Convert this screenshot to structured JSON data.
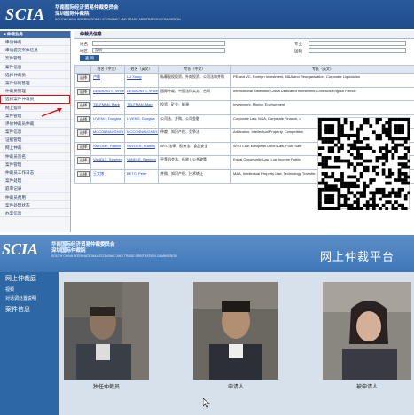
{
  "top": {
    "logo": "SCIA",
    "org_cn": "华南国际经济贸易仲裁委员会",
    "org_cn2": "深圳国际仲裁院",
    "org_en": "SOUTH CHINA INTERNATIONAL ECONOMIC AND TRADE ARBITRATION COMMISSION",
    "sidebar_head": "■ 仲裁业务",
    "sidebar_items": [
      "申请仲裁",
      "申请提交案件信息",
      "案件管理",
      "案件信息",
      "选择仲裁员",
      "案件标的管理",
      "仲裁员管理",
      "选择案件仲裁员",
      "网上提审",
      "案件管理",
      "评价仲裁员仲裁",
      "案件信息",
      "证据管理",
      "网上仲裁",
      "仲裁员签名",
      "案件管理",
      "仲裁员工作日志",
      "案件处理",
      "庭审记录",
      "仲裁员费用",
      "案件处理状态",
      "办案信息"
    ],
    "main_title": "仲裁员信息",
    "filter": {
      "name_label": "姓名",
      "region_label": "地区",
      "region_value": "深圳",
      "specialty_label": "专业",
      "nationality_label": "国籍",
      "search_button": "查 询"
    },
    "table_headers": [
      "",
      "姓名（中文）",
      "姓名（英文）",
      "专长（中文）",
      "专长（英文）"
    ],
    "rows": [
      {
        "sel": "选择",
        "cn": "卢雄",
        "en": "LU Xiong",
        "spec_cn": "私募股权投资、外商投资、公司法和并购",
        "spec_en": "PE and VC, Foreign Investment, M&A and Reorganization, Corporate Liquidation"
      },
      {
        "sel": "选择",
        "cn": "DESMONTS, Vincent",
        "en": "DESMONTS, Vincent",
        "spec_cn": "国际仲裁、中国法律实务、合同",
        "spec_en": "International Arbitration;China Dedicated Investment;Contracts;English French"
      },
      {
        "sel": "选择",
        "cn": "TELFMAN, Mark",
        "en": "TELFMAN, Mark",
        "spec_cn": "投资、矿业、能源",
        "spec_en": "Investment, Mining, Environment"
      },
      {
        "sel": "选择",
        "cn": "LIVENG, Douglas",
        "en": "LIVENG, Douglas",
        "spec_cn": "公司法、并购、公司金融",
        "spec_en": "Corporate Law, M&A, Corporate Finance, L"
      },
      {
        "sel": "选择",
        "cn": "MCCONNAUGHAY, Philip",
        "en": "MCCONNAUGHAY, Philip",
        "spec_cn": "仲裁、知识产权、竞争法",
        "spec_en": "Arbitration, Intellectual Property, Competition"
      },
      {
        "sel": "选择",
        "cn": "SNYDER, Francis",
        "en": "SNYDER, Francis",
        "spec_cn": "WTO法律、欧洲法、食品安全",
        "spec_en": "WTO Law, European Union Law, Food Safe"
      },
      {
        "sel": "选择",
        "cn": "VANDLE, Stephen",
        "en": "VANDLE, Stephen",
        "spec_cn": "平等机会法、低收入公共政策",
        "spec_en": "Equal Opportunity Law, Low Income Public"
      },
      {
        "sel": "选择",
        "cn": "王文博",
        "en": "BETO, Peter",
        "spec_cn": "并购、知识产权、技术转让",
        "spec_en": "M&A, Intellectual Property Law, Technology Transfer, International Trade"
      }
    ]
  },
  "bottom": {
    "logo": "SCIA",
    "org_cn": "华南国际经济贸易仲裁委员会",
    "org_cn2": "深圳国际仲裁院",
    "org_en": "SOUTH CHINA INTERNATIONAL ECONOMIC AND TRADE ARBITRATION COMMISSION",
    "title": "网上仲裁平台",
    "sidebar_items": [
      "网上仲裁庭",
      "视频",
      "对话调处置说明",
      "案件信息"
    ],
    "panels": [
      {
        "label": "独任仲裁员"
      },
      {
        "label": "申请人"
      },
      {
        "label": "被申请人"
      }
    ]
  },
  "colors": {
    "banner": "#1f4c8c",
    "bottom_banner": "#3f77b6",
    "bottom_sidebar": "#2d68a5",
    "stage": "#d6e1ec",
    "highlight": "#dd1111"
  }
}
